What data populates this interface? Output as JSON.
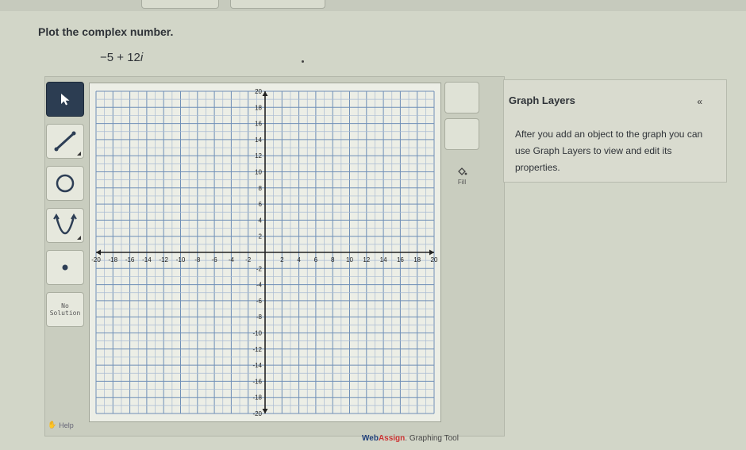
{
  "prompt": "Plot the complex number.",
  "complex_number": {
    "real": "−5",
    "op": "+",
    "imag": "12",
    "unit": "i"
  },
  "toolbar": {
    "tools": [
      {
        "name": "pointer-tool",
        "icon": "arrow-pointer-icon",
        "active": true
      },
      {
        "name": "line-tool",
        "icon": "line-segment-icon",
        "active": false
      },
      {
        "name": "circle-tool",
        "icon": "circle-icon",
        "active": false
      },
      {
        "name": "parabola-tool",
        "icon": "parabola-icon",
        "active": false
      },
      {
        "name": "point-tool",
        "icon": "point-icon",
        "active": false
      }
    ],
    "no_solution_label_1": "No",
    "no_solution_label_2": "Solution",
    "help_label": "Help"
  },
  "fill": {
    "label": "Fill",
    "icon": "paint-bucket-icon"
  },
  "graph": {
    "x_range": [
      -20,
      20
    ],
    "y_range": [
      -20,
      20
    ],
    "x_ticks": [
      "-20",
      "-18",
      "-16",
      "-14",
      "-12",
      "-10",
      "-8",
      "-6",
      "-4",
      "-2",
      "2",
      "4",
      "6",
      "8",
      "10",
      "12",
      "14",
      "16",
      "18",
      "20"
    ],
    "y_ticks": [
      "20",
      "18",
      "16",
      "14",
      "12",
      "10",
      "8",
      "6",
      "4",
      "2",
      "-2",
      "-4",
      "-6",
      "-8",
      "-10",
      "-12",
      "-14",
      "-16",
      "-18",
      "-20"
    ]
  },
  "layers": {
    "title": "Graph Layers",
    "collapse_symbol": "«",
    "message": "After you add an object to the graph you can use Graph Layers to view and edit its properties."
  },
  "footer": {
    "brand_web": "Web",
    "brand_assign": "Assign",
    "suffix": ". Graphing Tool"
  }
}
